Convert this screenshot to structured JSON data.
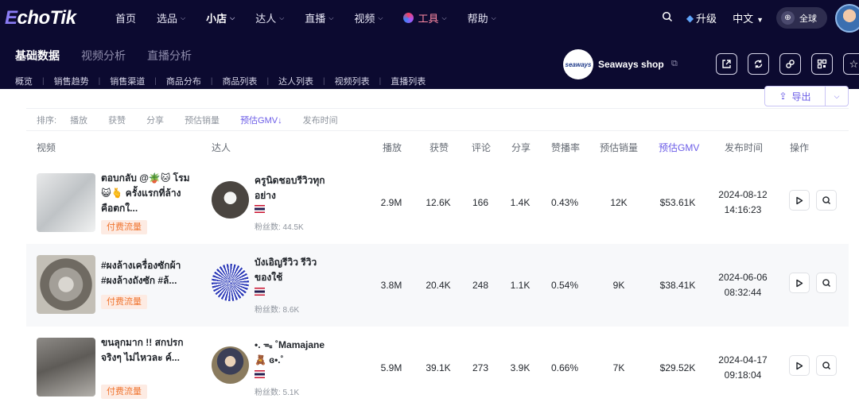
{
  "header": {
    "logo": "EchoTik",
    "nav": [
      {
        "label": "首页",
        "chevron": false,
        "active": false
      },
      {
        "label": "选品",
        "chevron": true,
        "active": false
      },
      {
        "label": "小店",
        "chevron": true,
        "active": true
      },
      {
        "label": "达人",
        "chevron": true,
        "active": false
      },
      {
        "label": "直播",
        "chevron": true,
        "active": false
      },
      {
        "label": "视频",
        "chevron": true,
        "active": false
      },
      {
        "label": "工具",
        "chevron": true,
        "active": false
      },
      {
        "label": "帮助",
        "chevron": true,
        "active": false
      }
    ],
    "upgrade": "升级",
    "language": "中文",
    "region": "全球"
  },
  "subheader": {
    "tabs": [
      "基础数据",
      "视频分析",
      "直播分析"
    ],
    "active_tab": 0,
    "links": [
      "概览",
      "销售趋势",
      "销售渠道",
      "商品分布",
      "商品列表",
      "达人列表",
      "视频列表",
      "直播列表"
    ],
    "shop_logo_text": "seaways",
    "shop_name": "Seaways shop"
  },
  "toolbar": {
    "export_label": "导出"
  },
  "sort": {
    "label": "排序:",
    "options": [
      "播放",
      "获赞",
      "分享",
      "预估销量",
      "预估GMV↓",
      "发布时间"
    ],
    "active": 4
  },
  "table": {
    "headers": [
      "视频",
      "达人",
      "播放",
      "获赞",
      "评论",
      "分享",
      "赞播率",
      "预估销量",
      "预估GMV",
      "发布时间",
      "操作"
    ],
    "rows": [
      {
        "title": "ตอบกลับ @🪴🐱 โรม😺🫰 ครั้งแรกที่ล้างคือตกใ...",
        "tag": "付费流量",
        "creator": "ครูนิดชอบรีวิวทุกอย่าง",
        "fans": "粉丝数: 44.5K",
        "plays": "2.9M",
        "likes": "12.6K",
        "comments": "166",
        "shares": "1.4K",
        "rate": "0.43%",
        "sales": "12K",
        "gmv": "$53.61K",
        "date": "2024-08-12",
        "time": "14:16:23"
      },
      {
        "title": "#ผงล้างเครื่องซักผ้า #ผงล้างถังซัก #ล้...",
        "tag": "付费流量",
        "creator": "บังเอิญรีวิว รีวิวของใช้",
        "fans": "粉丝数: 8.6K",
        "plays": "3.8M",
        "likes": "20.4K",
        "comments": "248",
        "shares": "1.1K",
        "rate": "0.54%",
        "sales": "9K",
        "gmv": "$38.41K",
        "date": "2024-06-06",
        "time": "08:32:44"
      },
      {
        "title": "ขนลุกมาก !! สกปรกจริงๆ ไม่ไหวละ ค์...",
        "tag": "付费流量",
        "creator": "•. ᯓ ˚Mamajane 🧸 ɞ•.˚",
        "fans": "粉丝数: 5.1K",
        "plays": "5.9M",
        "likes": "39.1K",
        "comments": "273",
        "shares": "3.9K",
        "rate": "0.66%",
        "sales": "7K",
        "gmv": "$29.52K",
        "date": "2024-04-17",
        "time": "09:18:04"
      }
    ]
  },
  "colors": {
    "header_bg": "#0c0a30",
    "accent": "#6b5ce7",
    "paid_tag": "#f07530"
  }
}
